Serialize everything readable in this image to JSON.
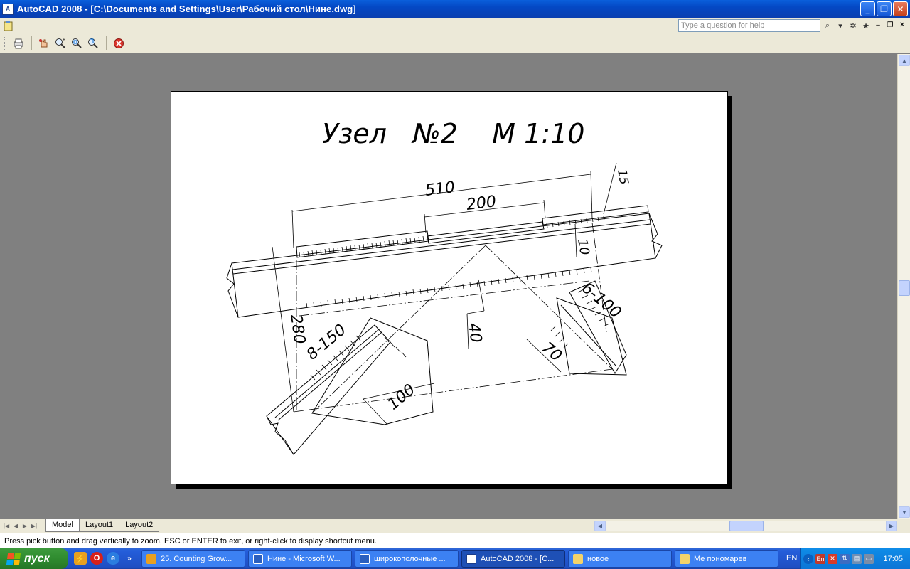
{
  "window": {
    "title": "AutoCAD 2008 - [C:\\Documents and Settings\\User\\Рабочий стол\\Нине.dwg]",
    "icon": "autocad-app-icon"
  },
  "menubar": {
    "help_placeholder": "Type a question for help"
  },
  "toolbar": {
    "icons": [
      "plot-icon",
      "pan-icon",
      "zoom-realtime-icon",
      "zoom-window-icon",
      "zoom-previous-icon",
      "close-preview-icon"
    ]
  },
  "drawing": {
    "title": "Узел   №2    М 1:10",
    "dims": {
      "d510": "510",
      "d200": "200",
      "d15": "15",
      "d10": "10",
      "d280": "280",
      "d8_150": "8-150",
      "d6_100": "6-100",
      "d40": "40",
      "d70": "70",
      "d100": "100"
    }
  },
  "tabs": [
    "Model",
    "Layout1",
    "Layout2"
  ],
  "command_line": "Press pick button and drag vertically to zoom, ESC or ENTER to exit, or right-click to display shortcut menu.",
  "taskbar": {
    "start_label": "пуск",
    "tasks": [
      {
        "label": "25. Counting Grow..."
      },
      {
        "label": "Нине - Microsoft W..."
      },
      {
        "label": "широкополочные ..."
      },
      {
        "label": "AutoCAD 2008 - [C..."
      },
      {
        "label": "новое"
      },
      {
        "label": "Ме пономарев"
      }
    ],
    "language": "EN",
    "clock": "17:05"
  }
}
